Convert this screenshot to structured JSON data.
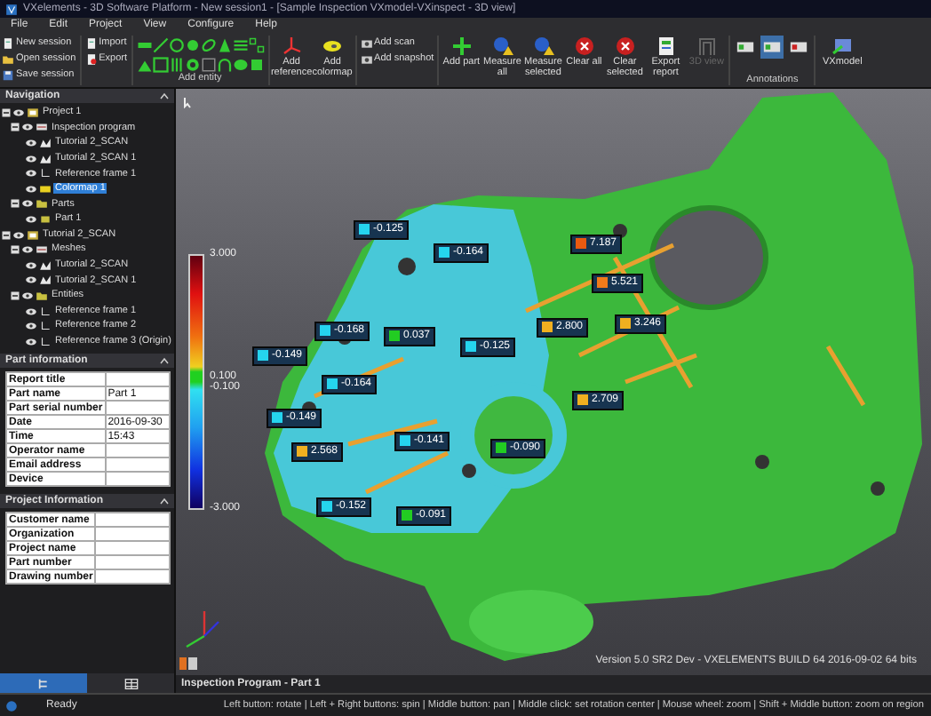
{
  "window": {
    "title": "VXelements - 3D Software Platform - New session1 - [Sample Inspection VXmodel-VXinspect - 3D view]"
  },
  "menu": [
    "File",
    "Edit",
    "Project",
    "View",
    "Configure",
    "Help"
  ],
  "ribbon": {
    "session": [
      "New session",
      "Open session",
      "Save session"
    ],
    "files": [
      "Import",
      "Export"
    ],
    "entity_label": "Add entity",
    "reference": [
      "Add reference",
      "Add colormap"
    ],
    "scan": [
      "Add scan",
      "Add snapshot"
    ],
    "inspect": [
      "Add part",
      "Measure all",
      "Measure selected",
      "Clear all",
      "Clear selected",
      "Export report"
    ],
    "view_3d": {
      "label": "3D view",
      "disabled": true
    },
    "annotations": {
      "label": "Annotations",
      "items": [
        {
          "selected": false
        },
        {
          "selected": true
        },
        {
          "selected": false
        }
      ]
    },
    "vxmodel": "VXmodel"
  },
  "navigation": {
    "title": "Navigation",
    "tree": [
      {
        "label": "Project 1",
        "kind": "project",
        "expanded": true,
        "selected": false,
        "children": [
          {
            "label": "Inspection program",
            "kind": "program",
            "expanded": true,
            "selected": false,
            "children": [
              {
                "label": "Tutorial 2_SCAN",
                "kind": "scan",
                "selected": false
              },
              {
                "label": "Tutorial 2_SCAN 1",
                "kind": "scan",
                "selected": false
              },
              {
                "label": "Reference frame 1",
                "kind": "reference",
                "selected": false
              },
              {
                "label": "Colormap 1",
                "kind": "colormap",
                "selected": true
              }
            ]
          },
          {
            "label": "Parts",
            "kind": "folder",
            "expanded": true,
            "selected": false,
            "children": [
              {
                "label": "Part 1",
                "kind": "part",
                "selected": false
              }
            ]
          }
        ]
      },
      {
        "label": "Tutorial 2_SCAN",
        "kind": "project",
        "expanded": true,
        "selected": false,
        "children": [
          {
            "label": "Meshes",
            "kind": "program",
            "expanded": true,
            "selected": false,
            "children": [
              {
                "label": "Tutorial 2_SCAN",
                "kind": "scan",
                "selected": false
              },
              {
                "label": "Tutorial 2_SCAN 1",
                "kind": "scan",
                "selected": false
              }
            ]
          },
          {
            "label": "Entities",
            "kind": "folder",
            "expanded": true,
            "selected": false,
            "children": [
              {
                "label": "Reference frame 1",
                "kind": "reference",
                "selected": false
              },
              {
                "label": "Reference frame 2",
                "kind": "reference",
                "selected": false
              },
              {
                "label": "Reference frame 3 (Origin)",
                "kind": "reference",
                "selected": false
              }
            ]
          }
        ]
      }
    ]
  },
  "part_information": {
    "title": "Part information",
    "rows": [
      {
        "label": "Report title"
      },
      {
        "label": "Part name",
        "value": "Part 1"
      },
      {
        "label": "Part serial number"
      },
      {
        "label": "Date",
        "value": "2016-09-30"
      },
      {
        "label": "Time",
        "value": "15:43"
      },
      {
        "label": "Operator name"
      },
      {
        "label": "Email address"
      },
      {
        "label": "Device"
      }
    ]
  },
  "project_information": {
    "title": "Project Information",
    "rows": [
      {
        "label": "Customer name"
      },
      {
        "label": "Organization"
      },
      {
        "label": "Project name"
      },
      {
        "label": "Part number"
      },
      {
        "label": "Drawing number"
      }
    ]
  },
  "panel_tabs": [
    {
      "selected": true
    },
    {
      "selected": false
    }
  ],
  "viewport": {
    "legend": [
      "3.000",
      "0.100",
      "-0.100",
      "-3.000"
    ],
    "annotations": [
      {
        "value": "-0.125",
        "color": "#25d4ee"
      },
      {
        "value": "-0.164",
        "color": "#25d4ee"
      },
      {
        "value": "7.187",
        "color": "#e85a10"
      },
      {
        "value": "5.521",
        "color": "#f07a1a"
      },
      {
        "value": "-0.168",
        "color": "#25d4ee"
      },
      {
        "value": "0.037",
        "color": "#22cc22"
      },
      {
        "value": "-0.149",
        "color": "#25d4ee"
      },
      {
        "value": "-0.125",
        "color": "#25d4ee"
      },
      {
        "value": "2.800",
        "color": "#f0b020"
      },
      {
        "value": "3.246",
        "color": "#f0b020"
      },
      {
        "value": "-0.164",
        "color": "#25d4ee"
      },
      {
        "value": "-0.149",
        "color": "#25d4ee"
      },
      {
        "value": "2.709",
        "color": "#f0b020"
      },
      {
        "value": "2.568",
        "color": "#f0b020"
      },
      {
        "value": "-0.141",
        "color": "#25d4ee"
      },
      {
        "value": "-0.090",
        "color": "#22cc22"
      },
      {
        "value": "-0.152",
        "color": "#25d4ee"
      },
      {
        "value": "-0.091",
        "color": "#22cc22"
      }
    ],
    "version": "Version 5.0 SR2 Dev - VXELEMENTS BUILD 64 2016-09-02 64 bits"
  },
  "info_bar": "Inspection Program - Part 1",
  "status_bar": {
    "state": "Ready",
    "hints": "Left button: rotate | Left + Right buttons: spin | Middle button: pan | Middle click: set rotation center | Mouse wheel: zoom | Shift + Middle button: zoom on region"
  }
}
